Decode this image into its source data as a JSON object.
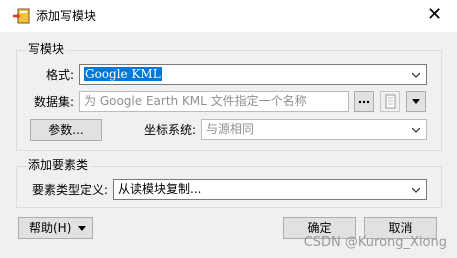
{
  "window": {
    "title": "添加写模块",
    "close_icon": "close-icon"
  },
  "write_group": {
    "title": "写模块",
    "format_label": "格式:",
    "format_value": "Google KML",
    "dataset_label": "数据集:",
    "dataset_placeholder": "为 Google Earth KML 文件指定一个名称",
    "params_button": "参数...",
    "coord_label": "坐标系统:",
    "coord_value": "与源相同"
  },
  "feature_group": {
    "title": "添加要素类",
    "def_label": "要素类型定义:",
    "def_value": "从读模块复制..."
  },
  "footer": {
    "help_button": "帮助(H)",
    "ok_button": "确定",
    "cancel_button": "取消"
  },
  "watermark": "CSDN @Kurong_Xiong"
}
